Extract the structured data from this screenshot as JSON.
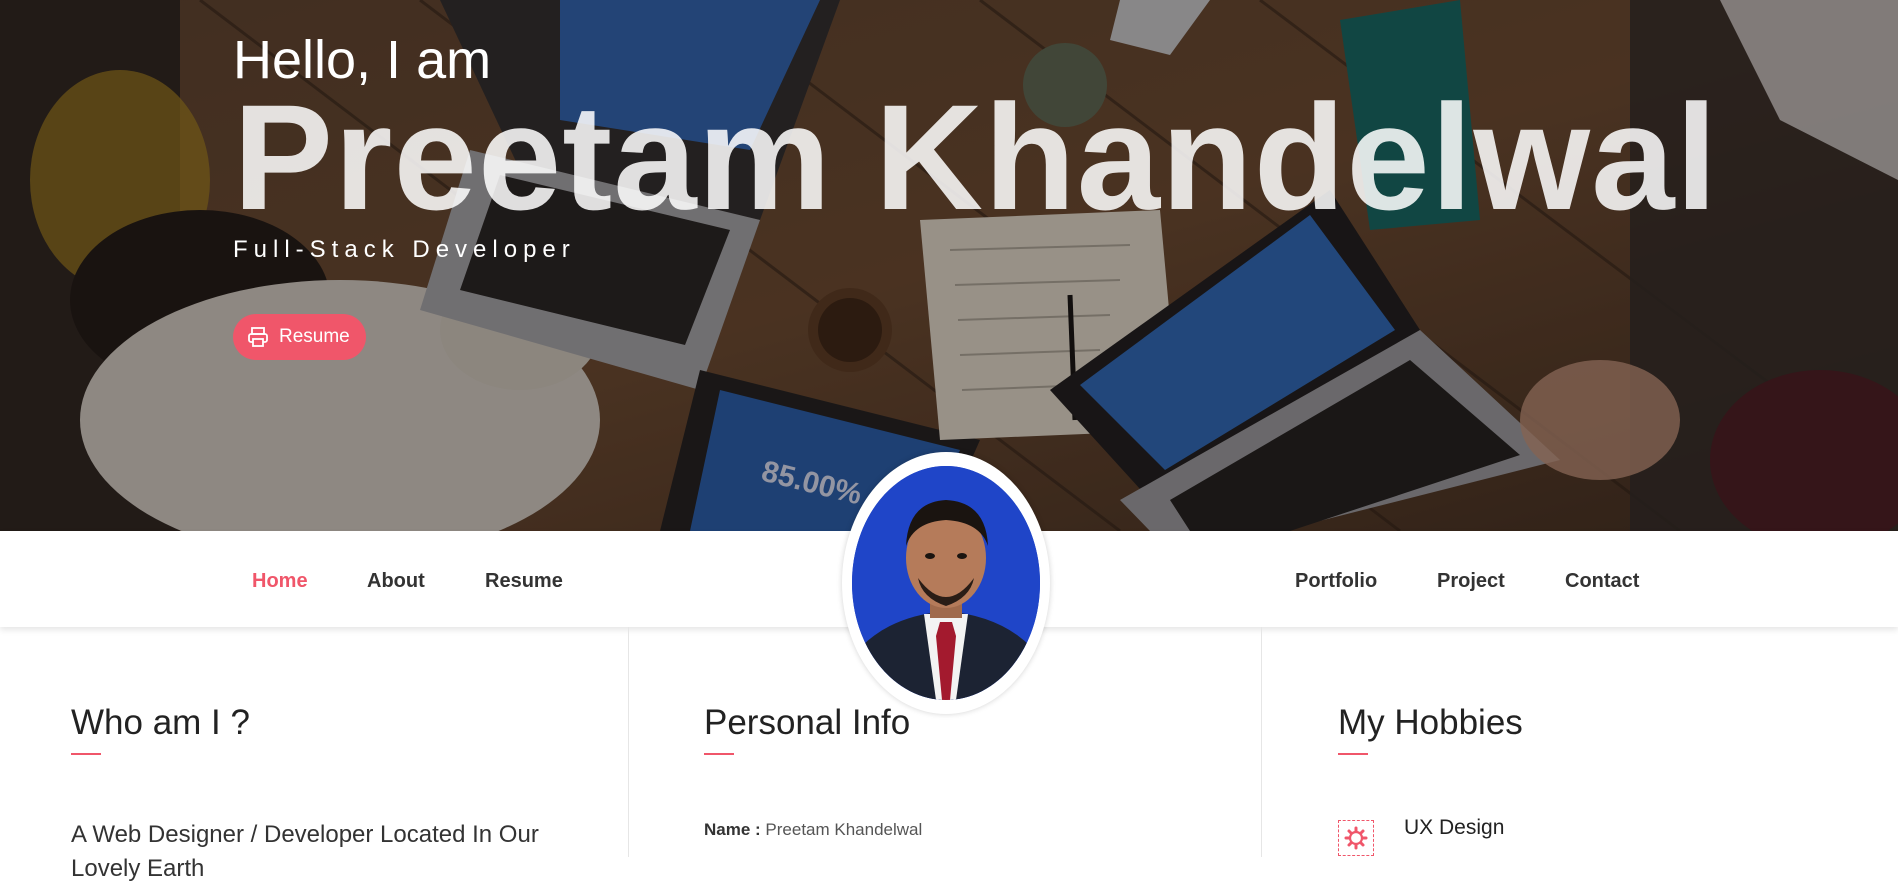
{
  "hero": {
    "greeting": "Hello, I am",
    "name": "Preetam Khandelwal",
    "role": "Full-Stack Developer",
    "resume_button": "Resume",
    "resume_icon": "printer-icon"
  },
  "nav": {
    "left": [
      "Home",
      "About",
      "Resume"
    ],
    "right": [
      "Portfolio",
      "Project",
      "Contact"
    ],
    "active": "Home"
  },
  "sections": {
    "about": {
      "title": "Who am I ?",
      "text": "A Web Designer / Developer Located In Our Lovely Earth"
    },
    "personal": {
      "title": "Personal Info",
      "name_label": "Name :",
      "name_value": "Preetam Khandelwal"
    },
    "hobbies": {
      "title": "My Hobbies",
      "first_label": "UX Design",
      "first_icon": "gear-icon"
    }
  },
  "colors": {
    "accent": "#f0566a",
    "text": "#333333"
  }
}
